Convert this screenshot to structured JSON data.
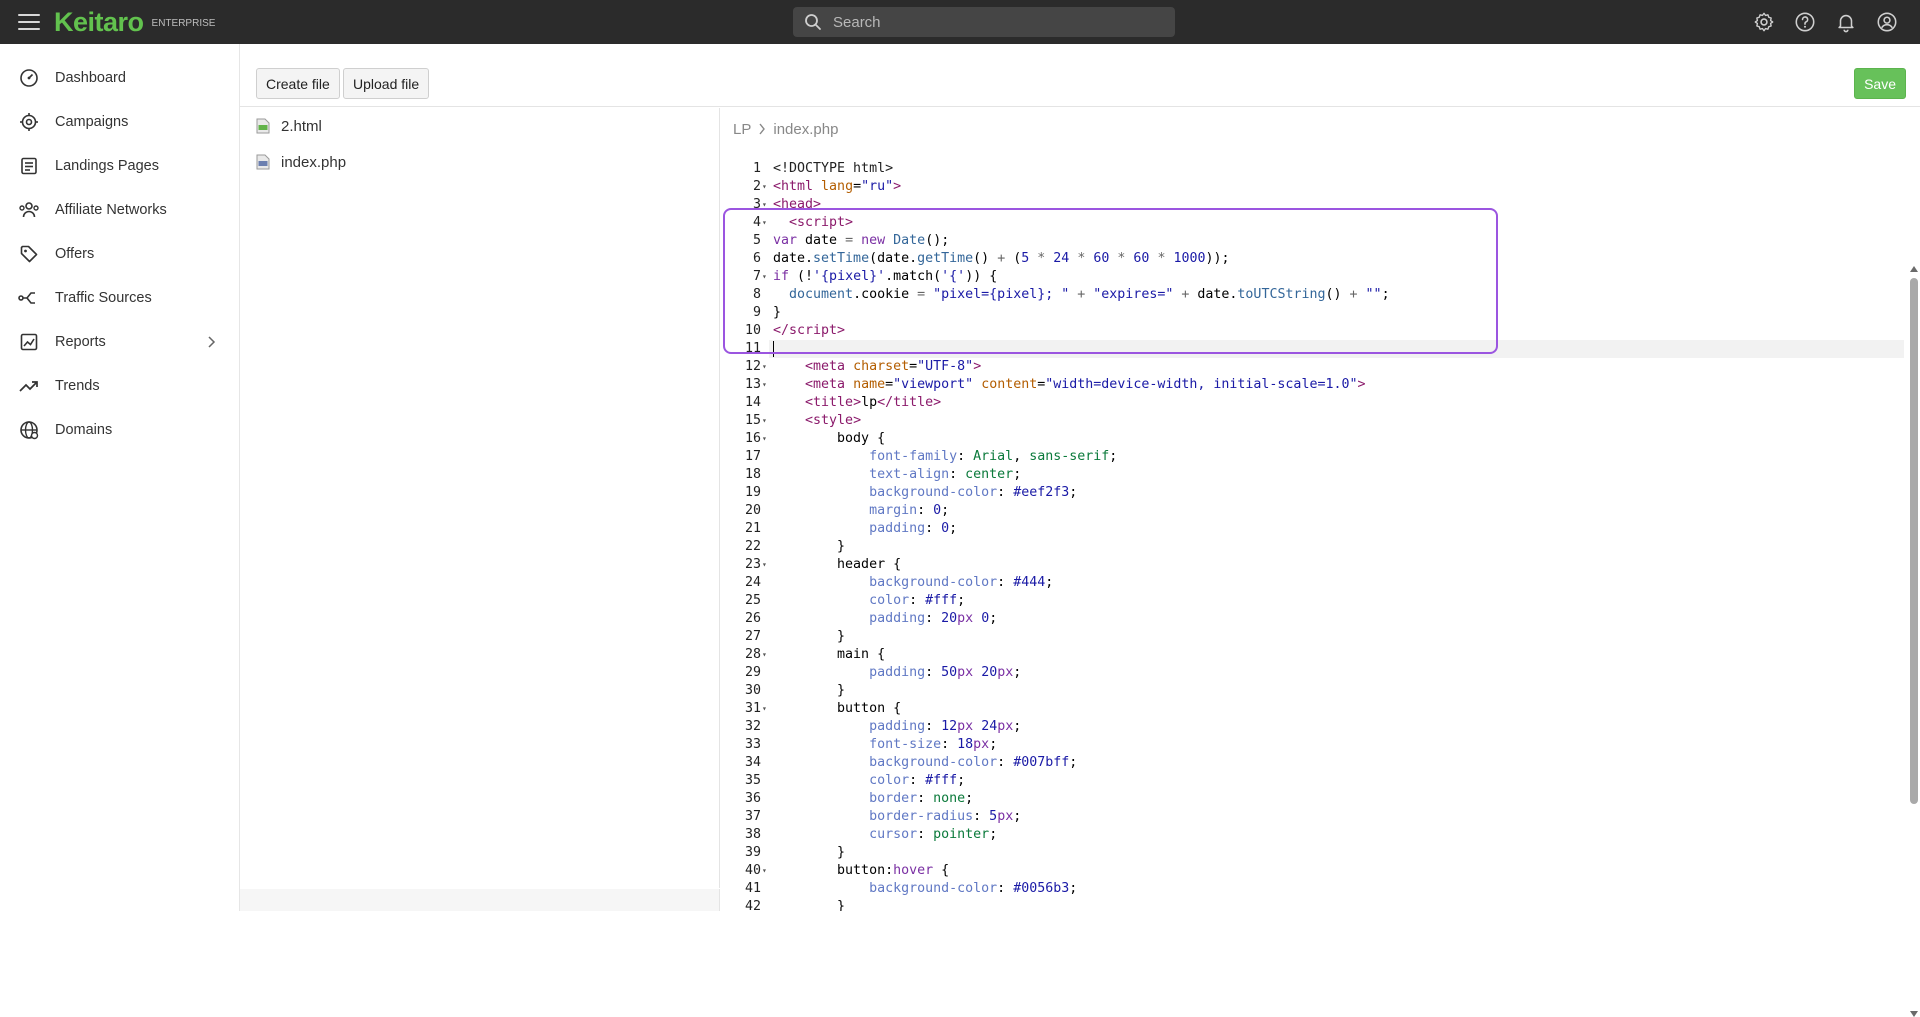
{
  "app": {
    "logo": "Keitaro",
    "edition": "ENTERPRISE",
    "accent_color": "#62c24e"
  },
  "search": {
    "placeholder": "Search",
    "value": ""
  },
  "top_icons": [
    "gear-icon",
    "help-icon",
    "bell-icon",
    "user-icon"
  ],
  "sidebar": {
    "items": [
      {
        "label": "Dashboard",
        "icon": "dashboard-icon"
      },
      {
        "label": "Campaigns",
        "icon": "target-icon"
      },
      {
        "label": "Landings Pages",
        "icon": "page-icon"
      },
      {
        "label": "Affiliate Networks",
        "icon": "users-icon"
      },
      {
        "label": "Offers",
        "icon": "tag-icon"
      },
      {
        "label": "Traffic Sources",
        "icon": "route-icon"
      },
      {
        "label": "Reports",
        "icon": "chart-icon",
        "has_submenu": true
      },
      {
        "label": "Trends",
        "icon": "trend-icon"
      },
      {
        "label": "Domains",
        "icon": "globe-icon"
      }
    ]
  },
  "toolbar": {
    "create_label": "Create file",
    "upload_label": "Upload file",
    "save_label": "Save",
    "save_color": "#67c15a"
  },
  "files": [
    {
      "name": "2.html",
      "icon": "html-file-icon"
    },
    {
      "name": "index.php",
      "icon": "php-file-icon"
    }
  ],
  "breadcrumb": {
    "root": "LP",
    "file": "index.php"
  },
  "editor": {
    "highlight_color": "#9b55e0",
    "active_line": 11,
    "lines": [
      {
        "n": "1",
        "fold": false,
        "html": "<span class='t-doc'>&lt;!DOCTYPE html&gt;</span>"
      },
      {
        "n": "2",
        "fold": true,
        "html": "<span class='t-tag'>&lt;html</span> <span class='t-attr'>lang</span>=<span class='t-str'>\"ru\"</span><span class='t-tag'>&gt;</span>"
      },
      {
        "n": "3",
        "fold": true,
        "html": "<span class='t-tag'>&lt;head&gt;</span>"
      },
      {
        "n": "4",
        "fold": true,
        "html": "  <span class='t-tag'>&lt;script&gt;</span>"
      },
      {
        "n": "5",
        "fold": false,
        "html": "<span class='t-kw'>var</span> date <span class='t-op'>=</span> <span class='t-kw'>new</span> <span class='t-fn'>Date</span>();"
      },
      {
        "n": "6",
        "fold": false,
        "html": "date.<span class='t-fn'>setTime</span>(date.<span class='t-fn'>getTime</span>() <span class='t-op'>+</span> (<span class='t-num'>5</span> <span class='t-op'>*</span> <span class='t-num'>24</span> <span class='t-op'>*</span> <span class='t-num'>60</span> <span class='t-op'>*</span> <span class='t-num'>60</span> <span class='t-op'>*</span> <span class='t-num'>1000</span>));"
      },
      {
        "n": "7",
        "fold": true,
        "html": "<span class='t-kw'>if</span> (!<span class='t-str'>'{pixel}'</span>.match(<span class='t-str'>'{'</span>)) {"
      },
      {
        "n": "8",
        "fold": false,
        "html": "  <span class='t-fn'>document</span>.cookie <span class='t-op'>=</span> <span class='t-str'>\"pixel={pixel}; \"</span> <span class='t-op'>+</span> <span class='t-str'>\"expires=\"</span> <span class='t-op'>+</span> date.<span class='t-fn'>toUTCString</span>() <span class='t-op'>+</span> <span class='t-str'>\"\"</span>;"
      },
      {
        "n": "9",
        "fold": false,
        "html": "}"
      },
      {
        "n": "10",
        "fold": false,
        "html": "<span class='t-tag'>&lt;/script&gt;</span>"
      },
      {
        "n": "11",
        "fold": false,
        "html": ""
      },
      {
        "n": "12",
        "fold": true,
        "html": "    <span class='t-tag'>&lt;meta</span> <span class='t-attr'>charset</span>=<span class='t-str'>\"UTF-8\"</span><span class='t-tag'>&gt;</span>"
      },
      {
        "n": "13",
        "fold": true,
        "html": "    <span class='t-tag'>&lt;meta</span> <span class='t-attr'>name</span>=<span class='t-str'>\"viewport\"</span> <span class='t-attr'>content</span>=<span class='t-str'>\"width=device-width, initial-scale=1.0\"</span><span class='t-tag'>&gt;</span>"
      },
      {
        "n": "14",
        "fold": false,
        "html": "    <span class='t-tag'>&lt;title&gt;</span>lp<span class='t-tag'>&lt;/title&gt;</span>"
      },
      {
        "n": "15",
        "fold": true,
        "html": "    <span class='t-tag'>&lt;style&gt;</span>"
      },
      {
        "n": "16",
        "fold": true,
        "html": "        body {"
      },
      {
        "n": "17",
        "fold": false,
        "html": "            <span class='t-prop'>font-family</span>: <span class='t-val'>Arial</span>, <span class='t-val'>sans-serif</span>;"
      },
      {
        "n": "18",
        "fold": false,
        "html": "            <span class='t-prop'>text-align</span>: <span class='t-val'>center</span>;"
      },
      {
        "n": "19",
        "fold": false,
        "html": "            <span class='t-prop'>background-color</span>: <span class='t-num'>#eef2f3</span>;"
      },
      {
        "n": "20",
        "fold": false,
        "html": "            <span class='t-prop'>margin</span>: <span class='t-num'>0</span>;"
      },
      {
        "n": "21",
        "fold": false,
        "html": "            <span class='t-prop'>padding</span>: <span class='t-num'>0</span>;"
      },
      {
        "n": "22",
        "fold": false,
        "html": "        }"
      },
      {
        "n": "23",
        "fold": true,
        "html": "        header {"
      },
      {
        "n": "24",
        "fold": false,
        "html": "            <span class='t-prop'>background-color</span>: <span class='t-num'>#444</span>;"
      },
      {
        "n": "25",
        "fold": false,
        "html": "            <span class='t-prop'>color</span>: <span class='t-num'>#fff</span>;"
      },
      {
        "n": "26",
        "fold": false,
        "html": "            <span class='t-prop'>padding</span>: <span class='t-num'>20</span><span class='t-kw'>px</span> <span class='t-num'>0</span>;"
      },
      {
        "n": "27",
        "fold": false,
        "html": "        }"
      },
      {
        "n": "28",
        "fold": true,
        "html": "        main {"
      },
      {
        "n": "29",
        "fold": false,
        "html": "            <span class='t-prop'>padding</span>: <span class='t-num'>50</span><span class='t-kw'>px</span> <span class='t-num'>20</span><span class='t-kw'>px</span>;"
      },
      {
        "n": "30",
        "fold": false,
        "html": "        }"
      },
      {
        "n": "31",
        "fold": true,
        "html": "        button {"
      },
      {
        "n": "32",
        "fold": false,
        "html": "            <span class='t-prop'>padding</span>: <span class='t-num'>12</span><span class='t-kw'>px</span> <span class='t-num'>24</span><span class='t-kw'>px</span>;"
      },
      {
        "n": "33",
        "fold": false,
        "html": "            <span class='t-prop'>font-size</span>: <span class='t-num'>18</span><span class='t-kw'>px</span>;"
      },
      {
        "n": "34",
        "fold": false,
        "html": "            <span class='t-prop'>background-color</span>: <span class='t-num'>#007bff</span>;"
      },
      {
        "n": "35",
        "fold": false,
        "html": "            <span class='t-prop'>color</span>: <span class='t-num'>#fff</span>;"
      },
      {
        "n": "36",
        "fold": false,
        "html": "            <span class='t-prop'>border</span>: <span class='t-val'>none</span>;"
      },
      {
        "n": "37",
        "fold": false,
        "html": "            <span class='t-prop'>border-radius</span>: <span class='t-num'>5</span><span class='t-kw'>px</span>;"
      },
      {
        "n": "38",
        "fold": false,
        "html": "            <span class='t-prop'>cursor</span>: <span class='t-val'>pointer</span>;"
      },
      {
        "n": "39",
        "fold": false,
        "html": "        }"
      },
      {
        "n": "40",
        "fold": true,
        "html": "        button:<span class='t-kw'>hover</span> {"
      },
      {
        "n": "41",
        "fold": false,
        "html": "            <span class='t-prop'>background-color</span>: <span class='t-num'>#0056b3</span>;"
      },
      {
        "n": "42",
        "fold": false,
        "html": "        }"
      }
    ]
  }
}
